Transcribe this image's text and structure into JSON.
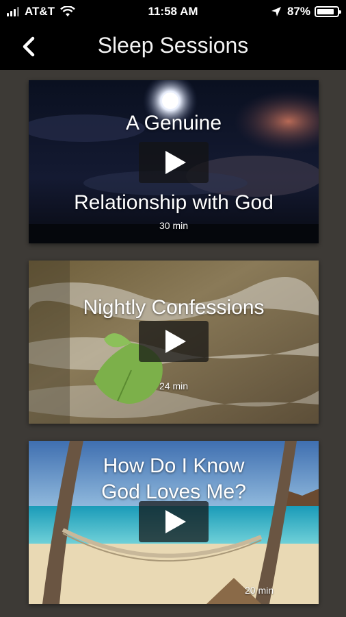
{
  "status_bar": {
    "carrier": "AT&T",
    "time": "11:58 AM",
    "battery_percent": "87%",
    "battery_level": 0.87,
    "icons": [
      "signal-icon",
      "wifi-icon",
      "location-arrow-icon",
      "battery-icon"
    ]
  },
  "nav": {
    "title": "Sleep Sessions",
    "back_icon": "chevron-left-icon"
  },
  "sessions": [
    {
      "title_line1": "A Genuine",
      "title_line2": "Relationship with God",
      "duration": "30 min"
    },
    {
      "title_line1": "Nightly Confessions",
      "duration": "24 min"
    },
    {
      "title_line1": "How Do I Know",
      "title_line2": "God Loves Me?",
      "duration": "20 min"
    }
  ],
  "colors": {
    "background": "#3d3a36",
    "bar": "#000000",
    "text": "#ffffff"
  }
}
